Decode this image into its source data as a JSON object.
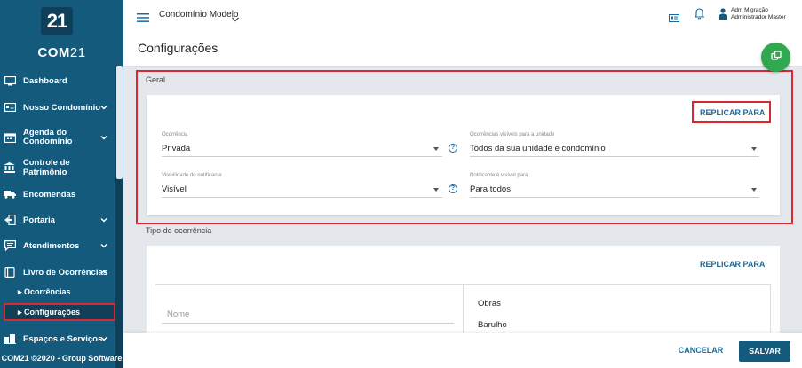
{
  "sidebar": {
    "logo": "21",
    "brand_bold": "COM",
    "brand_thin": "21",
    "items": [
      {
        "label": "Dashboard",
        "icon": "monitor-icon"
      },
      {
        "label": "Nosso Condomínio",
        "icon": "id-card-icon"
      },
      {
        "label": "Agenda do Condomínio",
        "icon": "calendar-icon"
      },
      {
        "label": "Controle de Patrimônio",
        "icon": "bank-icon"
      },
      {
        "label": "Encomendas",
        "icon": "truck-icon"
      },
      {
        "label": "Portaria",
        "icon": "door-icon"
      },
      {
        "label": "Atendimentos",
        "icon": "chat-icon"
      },
      {
        "label": "Livro de Ocorrências",
        "icon": "book-icon"
      },
      {
        "label": "Espaços e Serviços",
        "icon": "building-icon"
      }
    ],
    "agenda_line1": "Agenda do",
    "agenda_line2": "Condomínio",
    "sub_items": [
      {
        "label": "Ocorrências"
      },
      {
        "label": "Configurações"
      }
    ],
    "footer": "COM21 ©2020 - Group Software"
  },
  "topbar": {
    "condo_name": "Condomínio Modelo",
    "page_title": "Configurações",
    "user_name": "Adm Migração",
    "user_role": "Administrador Master"
  },
  "geral": {
    "section_label": "Geral",
    "replicate_label": "REPLICAR PARA",
    "fields": {
      "ocorrencia_label": "Ocorrência",
      "ocorrencia_value": "Privada",
      "visiveis_label": "Ocorrências visíveis para a unidade",
      "visiveis_value": "Todos da sua unidade e condomínio",
      "visibilidade_label": "Visibilidade do notificante",
      "visibilidade_value": "Visível",
      "notificante_label": "Notificante é visível para",
      "notificante_value": "Para todos"
    }
  },
  "tipo": {
    "section_label": "Tipo de ocorrência",
    "replicate_label": "REPLICAR PARA",
    "nome_placeholder": "Nome",
    "items": [
      "Obras",
      "Barulho"
    ]
  },
  "actions": {
    "cancel": "CANCELAR",
    "save": "SALVAR"
  },
  "colors": {
    "sidebar": "#145a7c",
    "accent": "#1a6a9a",
    "highlight": "#d9282f",
    "fab": "#2fa84f"
  }
}
